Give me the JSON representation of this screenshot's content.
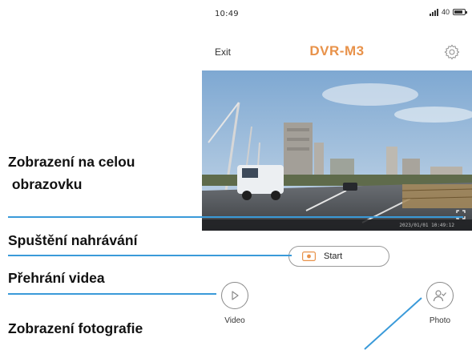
{
  "status_bar": {
    "time": "10:49",
    "battery_level": "40"
  },
  "nav": {
    "exit_label": "Exit",
    "title": "DVR-M3",
    "settings_icon": "gear-icon",
    "title_color": "#e8924a"
  },
  "video": {
    "timestamp": "2023/01/01 10:49:12"
  },
  "controls": {
    "start_label": "Start",
    "video_label": "Video",
    "photo_label": "Photo",
    "accent_color": "#e8924a"
  },
  "annotations": {
    "fullscreen_line1": "Zobrazení na celou",
    "fullscreen_line2": " obrazovku",
    "start_recording": "Spuštění nahrávání",
    "play_video": "Přehrání videa",
    "view_photos": "Zobrazení fotografie",
    "line_color": "#3a9ad9"
  }
}
